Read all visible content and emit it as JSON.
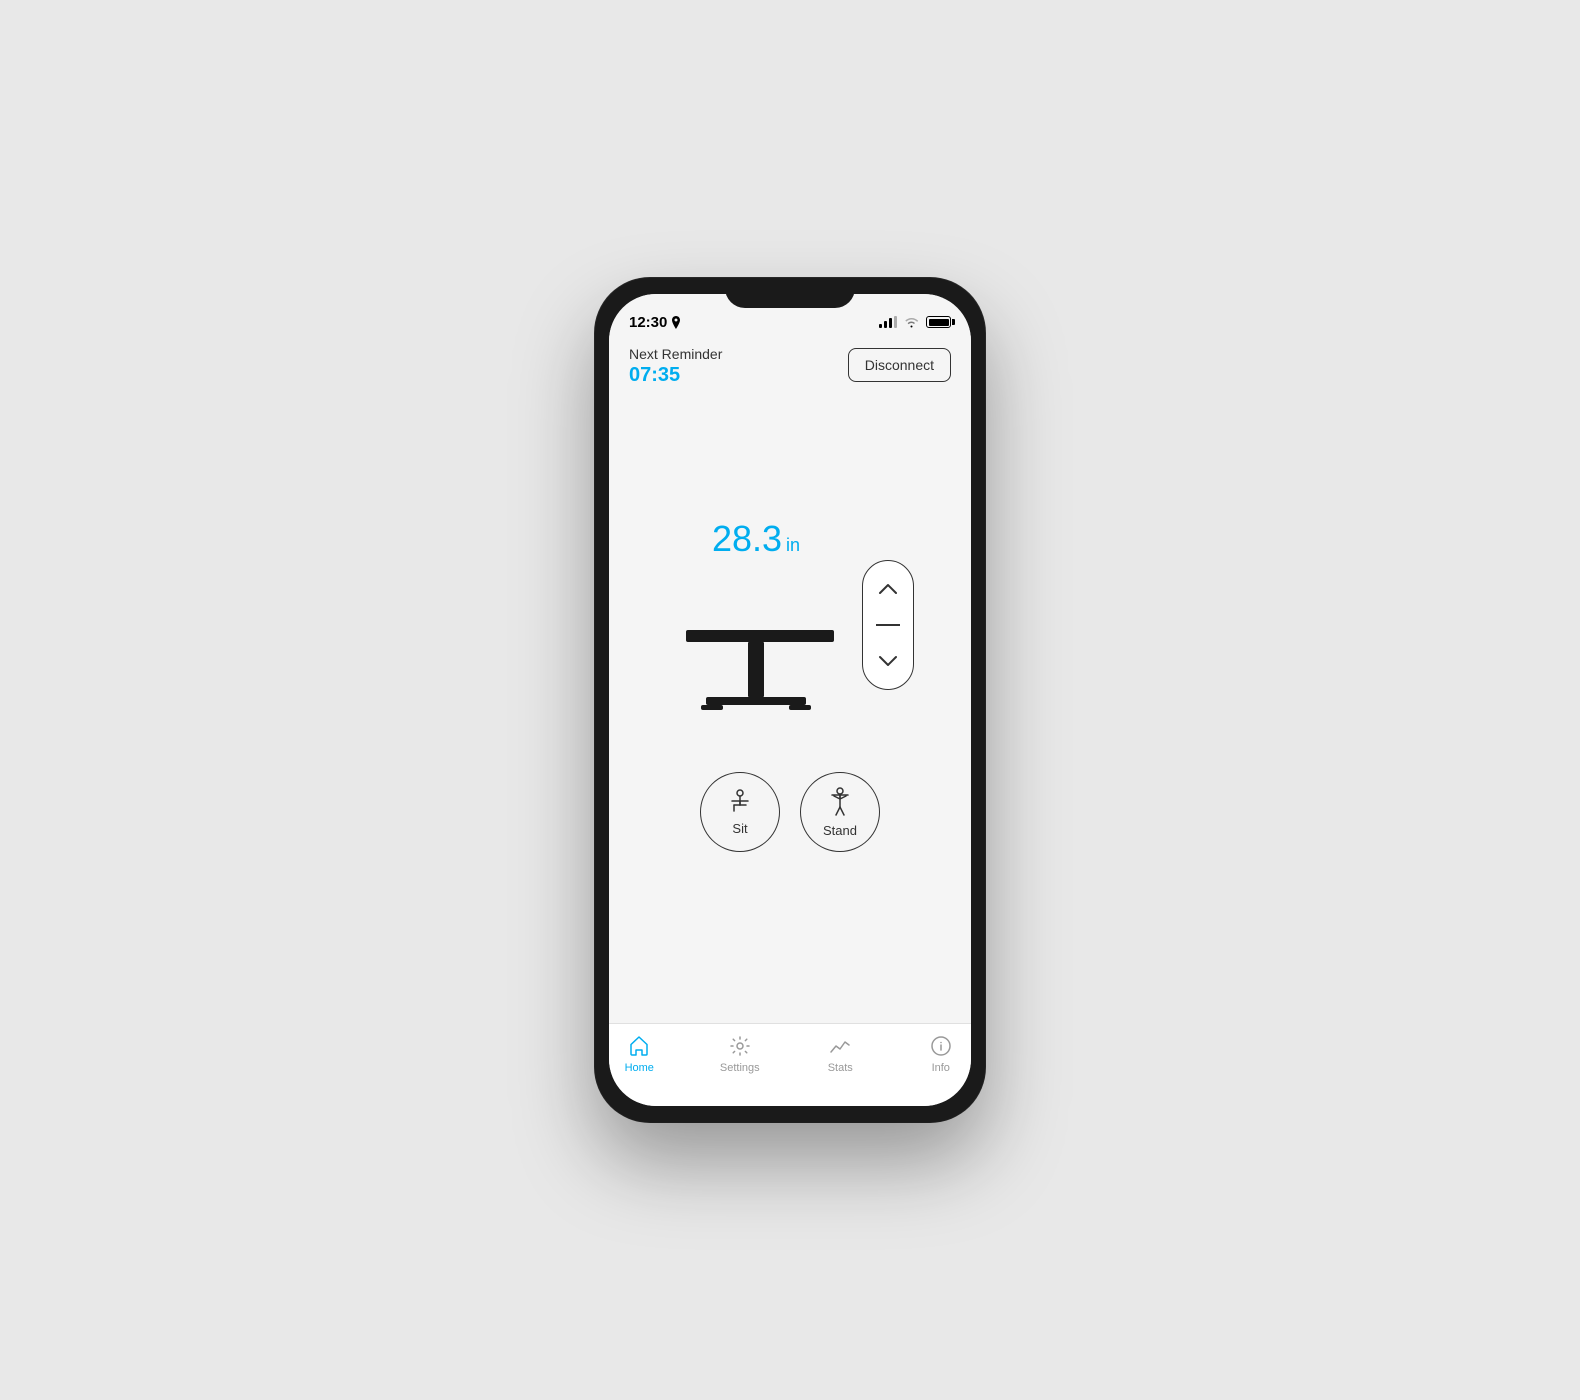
{
  "statusBar": {
    "time": "12:30",
    "hasLocation": true
  },
  "header": {
    "reminderLabel": "Next Reminder",
    "reminderTime": "07:35",
    "disconnectLabel": "Disconnect"
  },
  "desk": {
    "height": "28.3",
    "unit": "in"
  },
  "presets": [
    {
      "id": "sit",
      "label": "Sit"
    },
    {
      "id": "stand",
      "label": "Stand"
    }
  ],
  "controls": {
    "upLabel": "up",
    "downLabel": "down"
  },
  "tabBar": {
    "tabs": [
      {
        "id": "home",
        "label": "Home",
        "active": true
      },
      {
        "id": "settings",
        "label": "Settings",
        "active": false
      },
      {
        "id": "stats",
        "label": "Stats",
        "active": false
      },
      {
        "id": "info",
        "label": "Info",
        "active": false
      }
    ]
  }
}
